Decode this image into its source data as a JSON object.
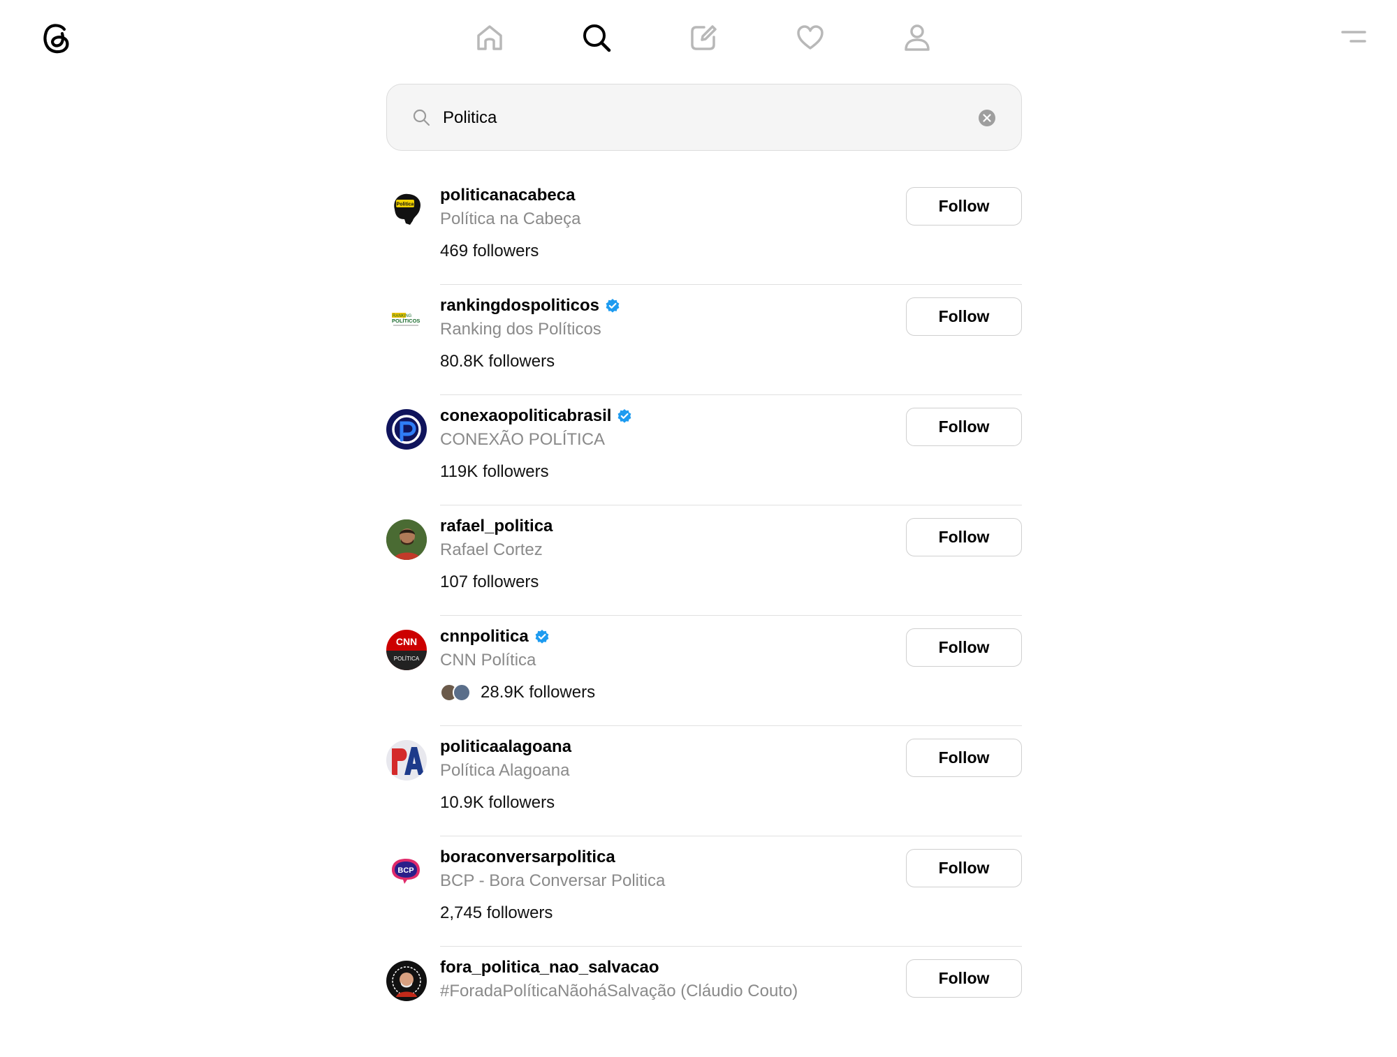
{
  "nav": {
    "items": [
      "home-icon",
      "search-icon",
      "new-thread-icon",
      "activity-heart-icon",
      "profile-icon"
    ],
    "active": "search-icon"
  },
  "search": {
    "value": "Politica",
    "placeholder": "Search"
  },
  "colors": {
    "verified": "#1d9bf0",
    "muted": "#8a8a8a",
    "border": "#cfcfcf"
  },
  "results": [
    {
      "username": "politicanacabeca",
      "display_name": "Política na Cabeça",
      "followers": "469 followers",
      "verified": false,
      "follow_label": "Follow",
      "avatar_text": "Politica"
    },
    {
      "username": "rankingdospoliticos",
      "display_name": "Ranking dos Políticos",
      "followers": "80.8K followers",
      "verified": true,
      "follow_label": "Follow",
      "avatar_text": "RANKING POLÍTICOS"
    },
    {
      "username": "conexaopoliticabrasil",
      "display_name": "CONEXÃO POLÍTICA",
      "followers": "119K followers",
      "verified": true,
      "follow_label": "Follow",
      "avatar_text": ""
    },
    {
      "username": "rafael_politica",
      "display_name": "Rafael Cortez",
      "followers": "107 followers",
      "verified": false,
      "follow_label": "Follow",
      "avatar_text": ""
    },
    {
      "username": "cnnpolitica",
      "display_name": "CNN Política",
      "followers": "28.9K followers",
      "verified": true,
      "follow_label": "Follow",
      "avatar_text": "CNN POLÍTICA",
      "mutual_avatars": true
    },
    {
      "username": "politicaalagoana",
      "display_name": "Política Alagoana",
      "followers": "10.9K followers",
      "verified": false,
      "follow_label": "Follow",
      "avatar_text": "PA"
    },
    {
      "username": "boraconversarpolitica",
      "display_name": "BCP - Bora Conversar Politica",
      "followers": "2,745 followers",
      "verified": false,
      "follow_label": "Follow",
      "avatar_text": "BCP"
    },
    {
      "username": "fora_politica_nao_salvacao",
      "display_name": "#ForadaPolíticaNãoháSalvação (Cláudio Couto)",
      "followers": "",
      "verified": false,
      "follow_label": "Follow",
      "avatar_text": ""
    }
  ]
}
